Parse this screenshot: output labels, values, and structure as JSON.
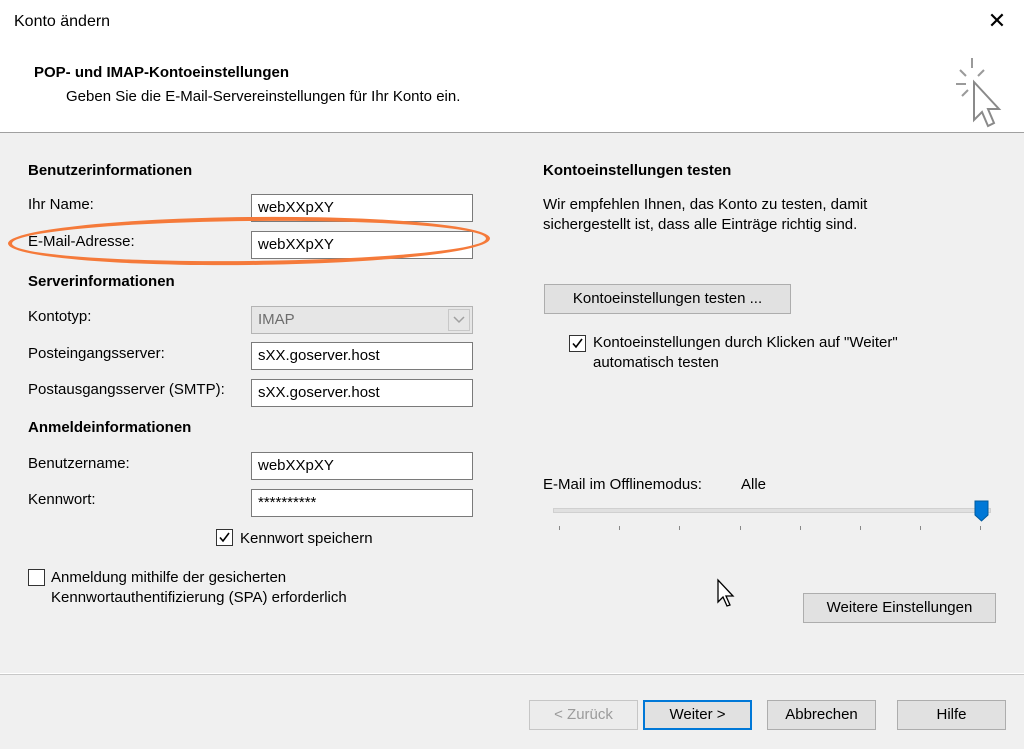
{
  "window": {
    "title": "Konto ändern",
    "close_glyph": "✕"
  },
  "header": {
    "title": "POP- und IMAP-Kontoeinstellungen",
    "subtitle": "Geben Sie die E-Mail-Servereinstellungen für Ihr Konto ein.",
    "icon": "wizard-cursor-icon"
  },
  "user_info": {
    "section": "Benutzerinformationen",
    "name_label": "Ihr Name:",
    "name_value": "webXXpXY",
    "email_label": "E-Mail-Adresse:",
    "email_value": "webXXpXY"
  },
  "server_info": {
    "section": "Serverinformationen",
    "type_label": "Kontotyp:",
    "type_value": "IMAP",
    "incoming_label": "Posteingangsserver:",
    "incoming_value": "sXX.goserver.host",
    "outgoing_label": "Postausgangsserver (SMTP):",
    "outgoing_value": "sXX.goserver.host"
  },
  "login_info": {
    "section": "Anmeldeinformationen",
    "username_label": "Benutzername:",
    "username_value": "webXXpXY",
    "password_label": "Kennwort:",
    "password_value": "**********",
    "save_password_label": "Kennwort speichern",
    "save_password_checked": true,
    "spa_label_1": "Anmeldung mithilfe der gesicherten",
    "spa_label_2": "Kennwortauthentifizierung (SPA) erforderlich",
    "spa_checked": false
  },
  "test": {
    "section": "Kontoeinstellungen testen",
    "desc_1": "Wir empfehlen Ihnen, das Konto zu testen, damit",
    "desc_2": "sichergestellt ist, dass alle Einträge richtig sind.",
    "test_button": "Kontoeinstellungen testen ...",
    "auto_test_label_1": "Kontoeinstellungen durch Klicken auf \"Weiter\"",
    "auto_test_label_2": "automatisch testen",
    "auto_test_checked": true
  },
  "offline": {
    "label": "E-Mail im Offlinemodus:",
    "value": "Alle",
    "slider_level": 1.0
  },
  "more_settings_button": "Weitere Einstellungen",
  "footer": {
    "back": "< Zurück",
    "next": "Weiter >",
    "cancel": "Abbrechen",
    "help": "Hilfe"
  },
  "colors": {
    "highlight_ellipse": "#f57a3a",
    "focus_border": "#0078d7",
    "slider_thumb": "#0078d7"
  }
}
